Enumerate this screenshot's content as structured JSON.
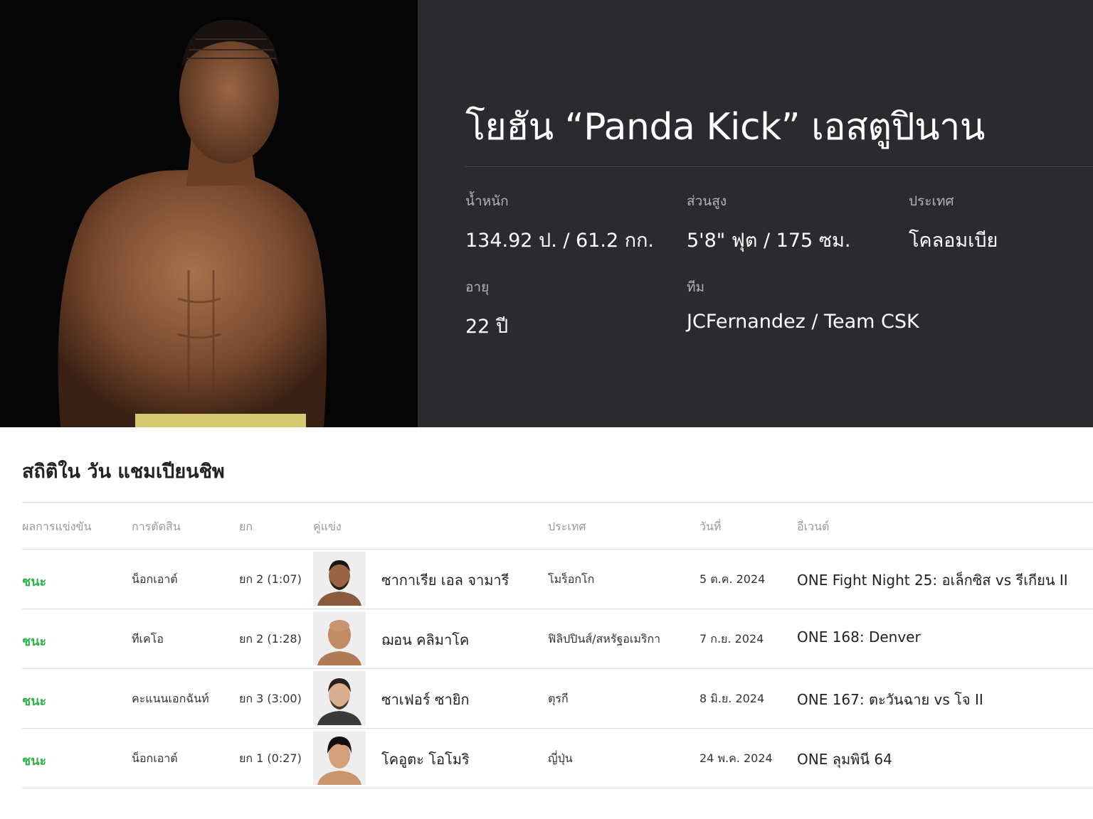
{
  "fighter": {
    "name": "โยฮัน “Panda Kick” เอสตูปินาน",
    "stats": {
      "weight": {
        "label": "น้ำหนัก",
        "value": "134.92 ป. / 61.2 กก."
      },
      "height": {
        "label": "ส่วนสูง",
        "value": "5'8\" ฟุต / 175 ซม."
      },
      "country": {
        "label": "ประเทศ",
        "value": "โคลอมเบีย"
      },
      "age": {
        "label": "อายุ",
        "value": "22 ปี"
      },
      "team": {
        "label": "ทีม",
        "value": "JCFernandez / Team CSK"
      }
    }
  },
  "record": {
    "title": "สถิติใน วัน แชมเปียนชิพ",
    "headers": {
      "result": "ผลการแข่งขัน",
      "method": "การตัดสิน",
      "round": "ยก",
      "opponent": "คู่แข่ง",
      "country": "ประเทศ",
      "date": "วันที่",
      "event": "อีเวนต์"
    },
    "rows": [
      {
        "result": "ชนะ",
        "method": "น็อกเอาต์",
        "round": "ยก 2 (1:07)",
        "opponent": "ซากาเรีย เอล จามารี",
        "country": "โมร็อกโก",
        "date": "5 ต.ค. 2024",
        "event": "ONE Fight Night 25: อเล็กซิส vs รีเกียน II"
      },
      {
        "result": "ชนะ",
        "method": "ทีเคโอ",
        "round": "ยก 2 (1:28)",
        "opponent": "ฌอน คลิมาโค",
        "country": "ฟิลิปปินส์/สหรัฐอเมริกา",
        "date": "7 ก.ย. 2024",
        "event": "ONE 168: Denver"
      },
      {
        "result": "ชนะ",
        "method": "คะแนนเอกฉันท์",
        "round": "ยก 3 (3:00)",
        "opponent": "ซาเฟอร์ ซายิก",
        "country": "ตุรกี",
        "date": "8 มิ.ย. 2024",
        "event": "ONE 167: ตะวันฉาย vs โจ II"
      },
      {
        "result": "ชนะ",
        "method": "น็อกเอาต์",
        "round": "ยก 1 (0:27)",
        "opponent": "โคอูตะ โอโมริ",
        "country": "ญี่ปุ่น",
        "date": "24 พ.ค. 2024",
        "event": "ONE ลุมพินี 64"
      }
    ]
  },
  "colors": {
    "hero_bg": "#2b2b2f",
    "photo_bg": "#050505",
    "win_green": "#2fb34a"
  }
}
